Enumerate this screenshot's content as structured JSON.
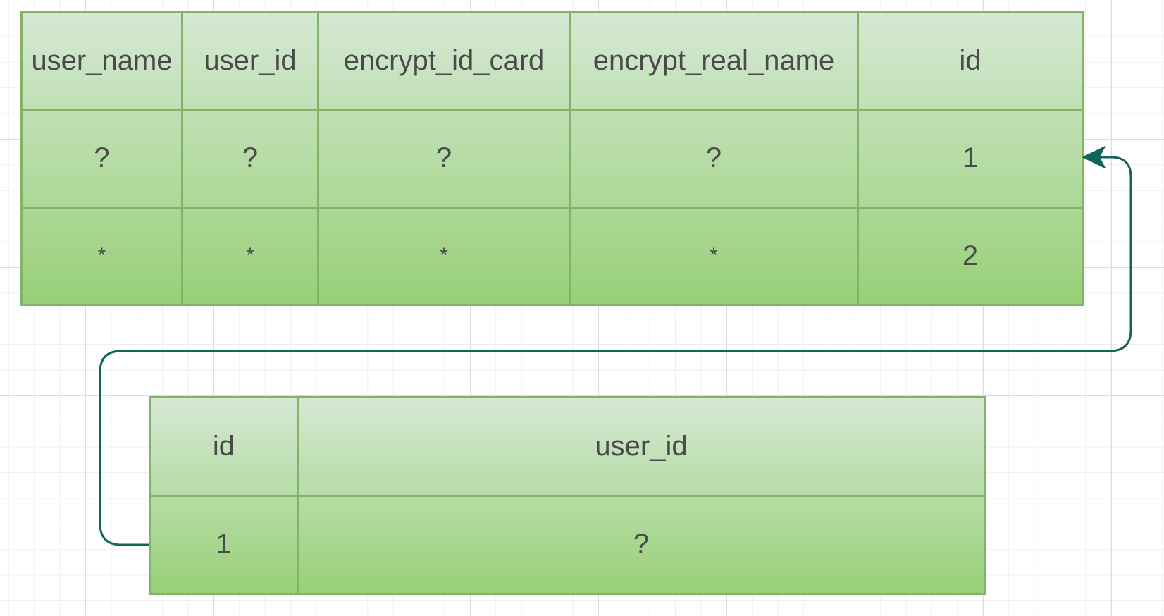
{
  "colors": {
    "cell_border": "#82b366",
    "fill_top": "#d5e8d4",
    "fill_bottom": "#97d077",
    "connector": "#11665a",
    "text": "#4a4a4a"
  },
  "top_table": {
    "headers": [
      "user_name",
      "user_id",
      "encrypt_id_card",
      "encrypt_real_name",
      "id"
    ],
    "rows": [
      [
        "?",
        "?",
        "?",
        "?",
        "1"
      ],
      [
        "*",
        "*",
        "*",
        "*",
        "2"
      ]
    ]
  },
  "bottom_table": {
    "headers": [
      "id",
      "user_id"
    ],
    "rows": [
      [
        "1",
        "?"
      ]
    ]
  }
}
